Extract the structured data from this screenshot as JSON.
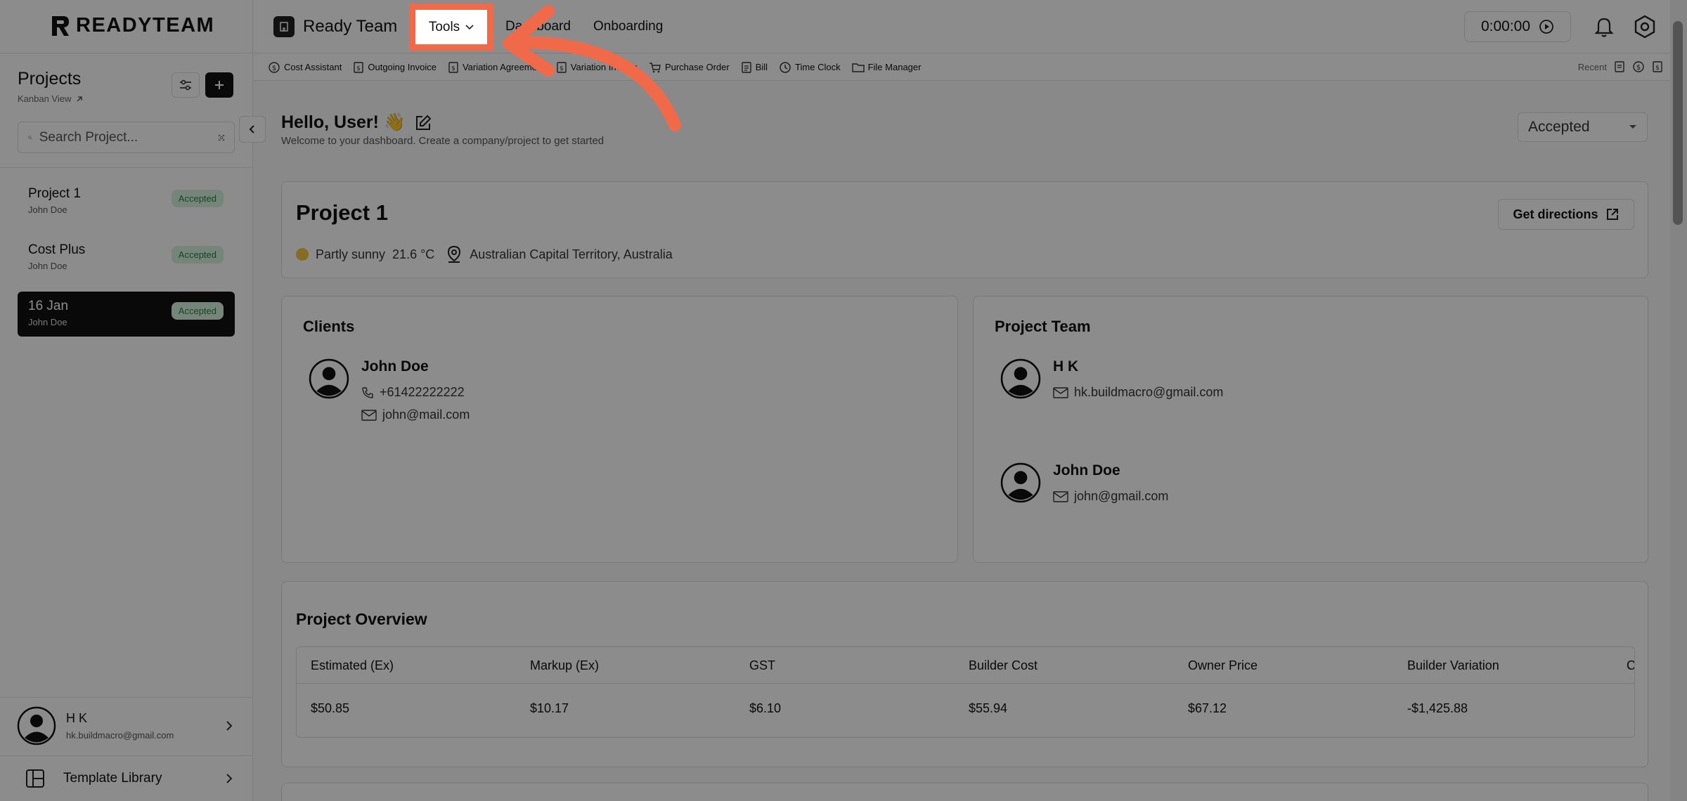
{
  "brand": {
    "name": "READYTEAM"
  },
  "sidebar": {
    "title": "Projects",
    "kanban_link": "Kanban View",
    "search_placeholder": "Search Project...",
    "projects": [
      {
        "name": "Project 1",
        "owner": "John Doe",
        "status": "Accepted"
      },
      {
        "name": "Cost Plus",
        "owner": "John Doe",
        "status": "Accepted"
      },
      {
        "name": "16 Jan",
        "owner": "John Doe",
        "status": "Accepted"
      }
    ],
    "user": {
      "name": "H K",
      "email": "hk.buildmacro@gmail.com"
    },
    "template_library": "Template Library"
  },
  "topbar": {
    "app_name": "Ready Team",
    "nav": {
      "tools": "Tools",
      "dashboard": "Dashboard",
      "onboarding": "Onboarding"
    },
    "timer": "0:00:00"
  },
  "toolsbar": {
    "items": [
      "Cost Assistant",
      "Outgoing Invoice",
      "Variation Agreement",
      "Variation Invoice",
      "Purchase Order",
      "Bill",
      "Time Clock",
      "File Manager"
    ],
    "recent_label": "Recent"
  },
  "main": {
    "greeting": "Hello, User! 👋",
    "welcome": "Welcome to your dashboard. Create a company/project to get started",
    "status_filter": "Accepted",
    "project": {
      "name": "Project 1",
      "weather": "Partly sunny",
      "temperature": "21.6 °C",
      "location": "Australian Capital Territory, Australia",
      "directions_button": "Get directions"
    },
    "clients": {
      "title": "Clients",
      "people": [
        {
          "name": "John Doe",
          "phone": "+61422222222",
          "email": "john@mail.com"
        }
      ]
    },
    "team": {
      "title": "Project Team",
      "people": [
        {
          "name": "H K",
          "email": "hk.buildmacro@gmail.com"
        },
        {
          "name": "John Doe",
          "email": "john@gmail.com"
        }
      ]
    },
    "overview": {
      "title": "Project Overview",
      "columns": [
        "Estimated (Ex)",
        "Markup (Ex)",
        "GST",
        "Builder Cost",
        "Owner Price",
        "Builder Variation",
        "C"
      ],
      "row": [
        "$50.85",
        "$10.17",
        "$6.10",
        "$55.94",
        "$67.12",
        "-$1,425.88"
      ]
    }
  },
  "colors": {
    "highlight": "#f06a4a",
    "badge_bg": "#d6f2df",
    "badge_text": "#2f7a4a"
  }
}
